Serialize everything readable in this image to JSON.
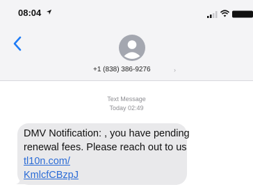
{
  "status_bar": {
    "time": "08:04",
    "icons": [
      "location-arrow-icon",
      "cellular-signal-icon",
      "wifi-icon",
      "battery-icon"
    ]
  },
  "header": {
    "back_icon": "chevron-left-icon",
    "contact": "+1 (838) 386-9276",
    "chevron": "›"
  },
  "thread": {
    "message_type": "Text Message",
    "timestamp": "Today 02:49",
    "message": {
      "text": "DMV Notification: , you have pending renewal fees. Please reach out to us ",
      "link_line1": "tl10n.com/",
      "link_line2": "KmlcfCBzpJ"
    }
  },
  "colors": {
    "header_bg": "#f4f4f6",
    "bubble_bg": "#e9e9eb",
    "link": "#2a6bd6",
    "accent": "#1f7cf6",
    "meta": "#8e8e93"
  }
}
